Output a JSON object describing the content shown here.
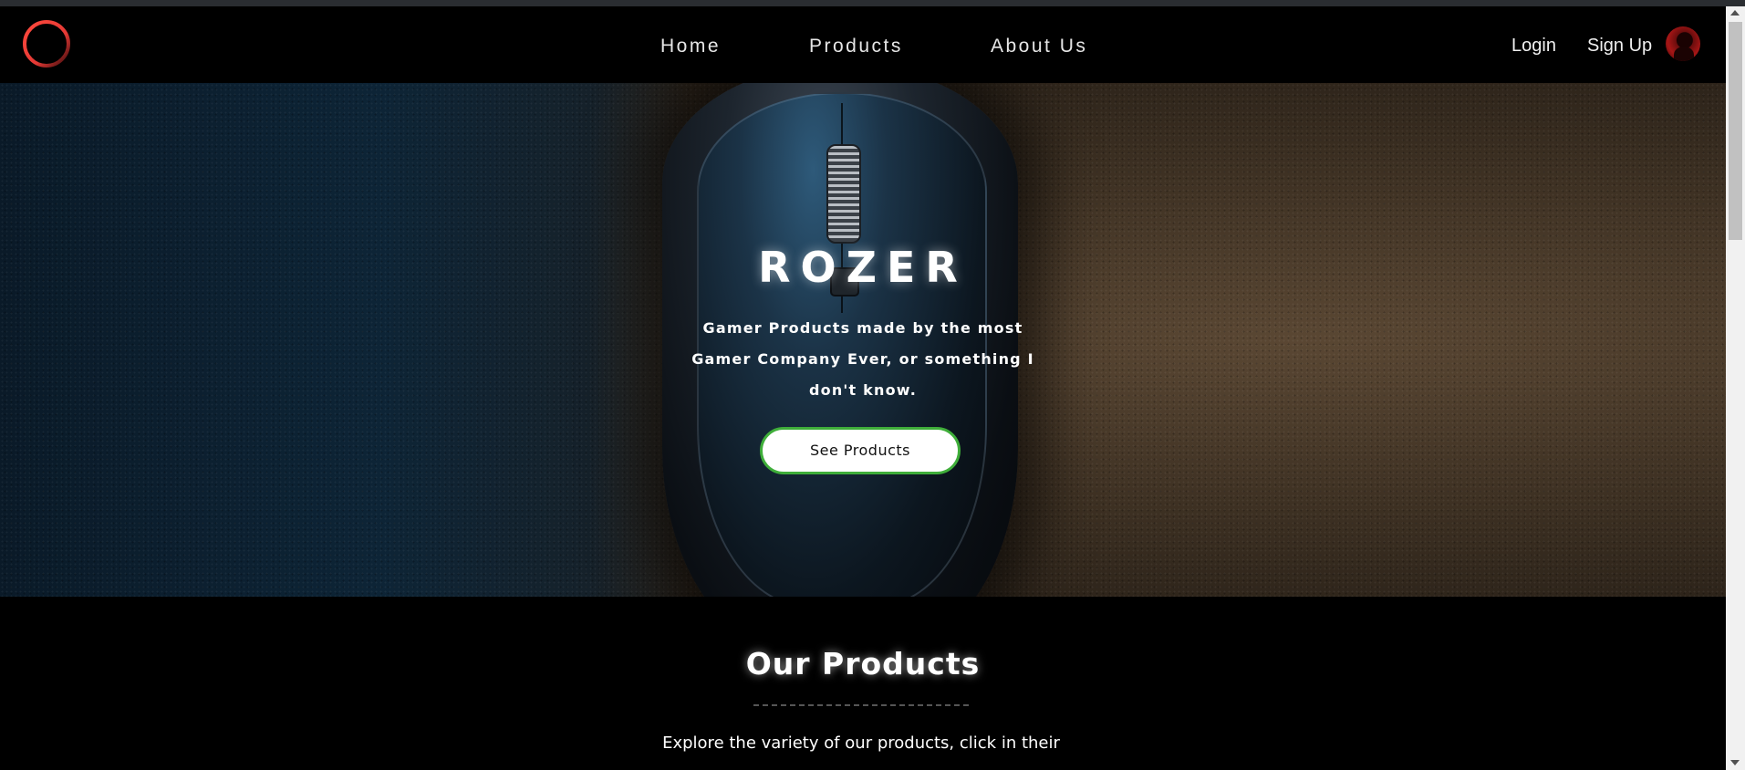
{
  "nav": {
    "links": [
      "Home",
      "Products",
      "About Us"
    ],
    "login_label": "Login",
    "signup_label": "Sign Up"
  },
  "hero": {
    "title": "ROZER",
    "subtitle": "Gamer Products made by the most Gamer Company Ever, or something I don't know.",
    "cta_label": "See Products"
  },
  "products_section": {
    "title": "Our Products",
    "description": "Explore the variety of our products, click in their"
  },
  "colors": {
    "logo_ring": "#e53935",
    "cta_border": "#3fae3a",
    "background": "#000000"
  },
  "icons": {
    "logo": "ring-logo-icon",
    "avatar": "user-avatar-icon"
  }
}
